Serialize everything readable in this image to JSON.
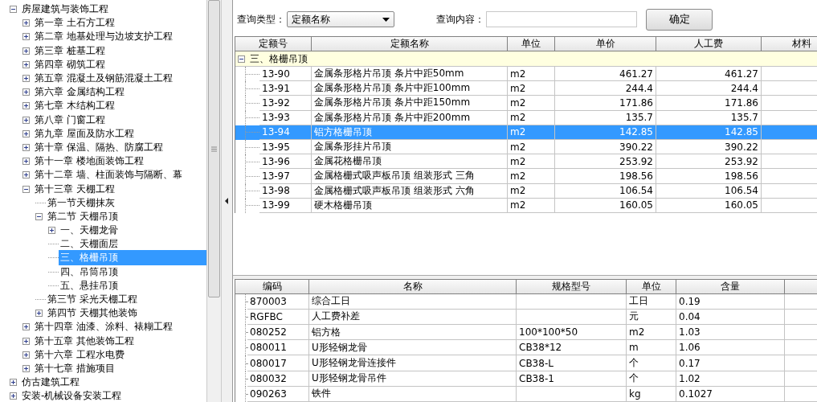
{
  "tree": [
    {
      "label": "房屋建筑与装饰工程",
      "expanded": true,
      "selected": false,
      "children": [
        {
          "label": "第一章 土石方工程",
          "expanded": false,
          "selected": false
        },
        {
          "label": "第二章 地基处理与边坡支护工程",
          "expanded": false,
          "selected": false
        },
        {
          "label": "第三章 桩基工程",
          "expanded": false,
          "selected": false
        },
        {
          "label": "第四章 砌筑工程",
          "expanded": false,
          "selected": false
        },
        {
          "label": "第五章 混凝土及钢筋混凝土工程",
          "expanded": false,
          "selected": false
        },
        {
          "label": "第六章 金属结构工程",
          "expanded": false,
          "selected": false
        },
        {
          "label": "第七章 木结构工程",
          "expanded": false,
          "selected": false
        },
        {
          "label": "第八章 门窗工程",
          "expanded": false,
          "selected": false
        },
        {
          "label": "第九章 屋面及防水工程",
          "expanded": false,
          "selected": false
        },
        {
          "label": "第十章 保温、隔热、防腐工程",
          "expanded": false,
          "selected": false
        },
        {
          "label": "第十一章 楼地面装饰工程",
          "expanded": false,
          "selected": false
        },
        {
          "label": "第十二章 墙、柱面装饰与隔断、幕",
          "expanded": false,
          "selected": false
        },
        {
          "label": "第十三章 天棚工程",
          "expanded": true,
          "selected": false,
          "children": [
            {
              "label": "第一节天棚抹灰",
              "selected": false
            },
            {
              "label": "第二节 天棚吊顶",
              "expanded": true,
              "selected": false,
              "children": [
                {
                  "label": "一、天棚龙骨",
                  "expanded": false,
                  "selected": false
                },
                {
                  "label": "二、天棚面层",
                  "selected": false
                },
                {
                  "label": "三、格栅吊顶",
                  "selected": true
                },
                {
                  "label": "四、吊筒吊顶",
                  "selected": false
                },
                {
                  "label": "五、悬挂吊顶",
                  "selected": false
                }
              ]
            },
            {
              "label": "第三节 采光天棚工程",
              "selected": false
            },
            {
              "label": "第四节 天棚其他装饰",
              "expanded": false,
              "selected": false
            }
          ]
        },
        {
          "label": "第十四章 油漆、涂料、裱糊工程",
          "expanded": false,
          "selected": false
        },
        {
          "label": "第十五章 其他装饰工程",
          "expanded": false,
          "selected": false
        },
        {
          "label": "第十六章 工程水电费",
          "expanded": false,
          "selected": false
        },
        {
          "label": "第十七章 措施项目",
          "expanded": false,
          "selected": false
        }
      ]
    },
    {
      "label": "仿古建筑工程",
      "expanded": false,
      "selected": false
    },
    {
      "label": "安装-机械设备安装工程",
      "expanded": false,
      "selected": false
    }
  ],
  "query": {
    "type_label": "查询类型：",
    "type_value": "定额名称",
    "content_label": "查询内容：",
    "button": "确定"
  },
  "quota_table": {
    "columns": [
      "定额号",
      "定额名称",
      "单位",
      "单价",
      "人工费",
      "材料"
    ],
    "group": {
      "label": "三、格栅吊顶",
      "expanded": true
    },
    "rows": [
      {
        "cells": [
          "13-90",
          "金属条形格片吊顶 条片中距50mm",
          "m2",
          "461.27",
          "461.27"
        ],
        "selected": false
      },
      {
        "cells": [
          "13-91",
          "金属条形格片吊顶 条片中距100mm",
          "m2",
          "244.4",
          "244.4"
        ],
        "selected": false
      },
      {
        "cells": [
          "13-92",
          "金属条形格片吊顶 条片中距150mm",
          "m2",
          "171.86",
          "171.86"
        ],
        "selected": false
      },
      {
        "cells": [
          "13-93",
          "金属条形格片吊顶 条片中距200mm",
          "m2",
          "135.7",
          "135.7"
        ],
        "selected": false
      },
      {
        "cells": [
          "13-94",
          "铝方格栅吊顶",
          "m2",
          "142.85",
          "142.85"
        ],
        "selected": true
      },
      {
        "cells": [
          "13-95",
          "金属条形挂片吊顶",
          "m2",
          "390.22",
          "390.22"
        ],
        "selected": false
      },
      {
        "cells": [
          "13-96",
          "金属花格栅吊顶",
          "m2",
          "253.92",
          "253.92"
        ],
        "selected": false
      },
      {
        "cells": [
          "13-97",
          "金属格栅式吸声板吊顶 组装形式 三角",
          "m2",
          "198.56",
          "198.56"
        ],
        "selected": false
      },
      {
        "cells": [
          "13-98",
          "金属格栅式吸声板吊顶 组装形式 六角",
          "m2",
          "106.54",
          "106.54"
        ],
        "selected": false
      },
      {
        "cells": [
          "13-99",
          "硬木格栅吊顶",
          "m2",
          "160.05",
          "160.05"
        ],
        "selected": false
      }
    ]
  },
  "material_table": {
    "columns": [
      "编码",
      "名称",
      "规格型号",
      "单位",
      "含量"
    ],
    "rows": [
      [
        "870003",
        "综合工日",
        "",
        "工日",
        "0.19"
      ],
      [
        "RGFBC",
        "人工费补差",
        "",
        "元",
        "0.04"
      ],
      [
        "080252",
        "铝方格",
        "100*100*50",
        "m2",
        "1.03"
      ],
      [
        "080011",
        "U形轻钢龙骨",
        "CB38*12",
        "m",
        "1.06"
      ],
      [
        "080017",
        "U形轻钢龙骨连接件",
        "CB38-L",
        "个",
        "0.17"
      ],
      [
        "080032",
        "U形轻钢龙骨吊件",
        "CB38-1",
        "个",
        "1.02"
      ],
      [
        "090263",
        "铁件",
        "",
        "kg",
        "0.1027"
      ]
    ]
  }
}
